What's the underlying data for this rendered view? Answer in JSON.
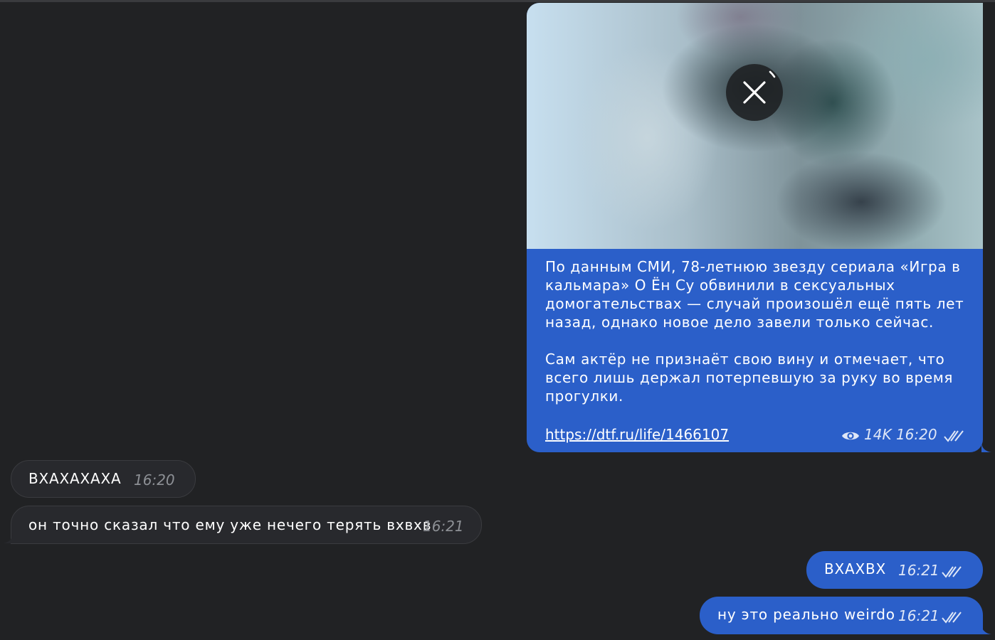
{
  "messages": {
    "media_post": {
      "caption": "По данным СМИ, 78-летнюю звезду сериала «Игра в кальмара» О Ён Су обвинили в сексуальных домогательствах — случай произошёл ещё пять лет назад, однако новое дело завели только сейчас.\n\nСам актёр не признаёт свою вину и отмечает, что всего лишь держал потерпевшую за руку во время прогулки.",
      "link": "https://dtf.ru/life/1466107",
      "views": "14K",
      "time": "16:20"
    },
    "in_1": {
      "text": "ВХАХАХАХА",
      "time": "16:20"
    },
    "in_2": {
      "text": "он точно сказал что ему уже нечего терять вхвхв",
      "time": "16:21"
    },
    "out_1": {
      "text": "ВХАХВХ",
      "time": "16:21"
    },
    "out_2": {
      "text": "ну это реально weirdo",
      "time": "16:21"
    }
  },
  "icons": {
    "cancel": "close-icon",
    "views": "eye-icon",
    "read": "double-check-icon"
  },
  "colors": {
    "background": "#212224",
    "outgoing_bubble": "#2b5fc9",
    "incoming_bubble": "#28292d"
  }
}
